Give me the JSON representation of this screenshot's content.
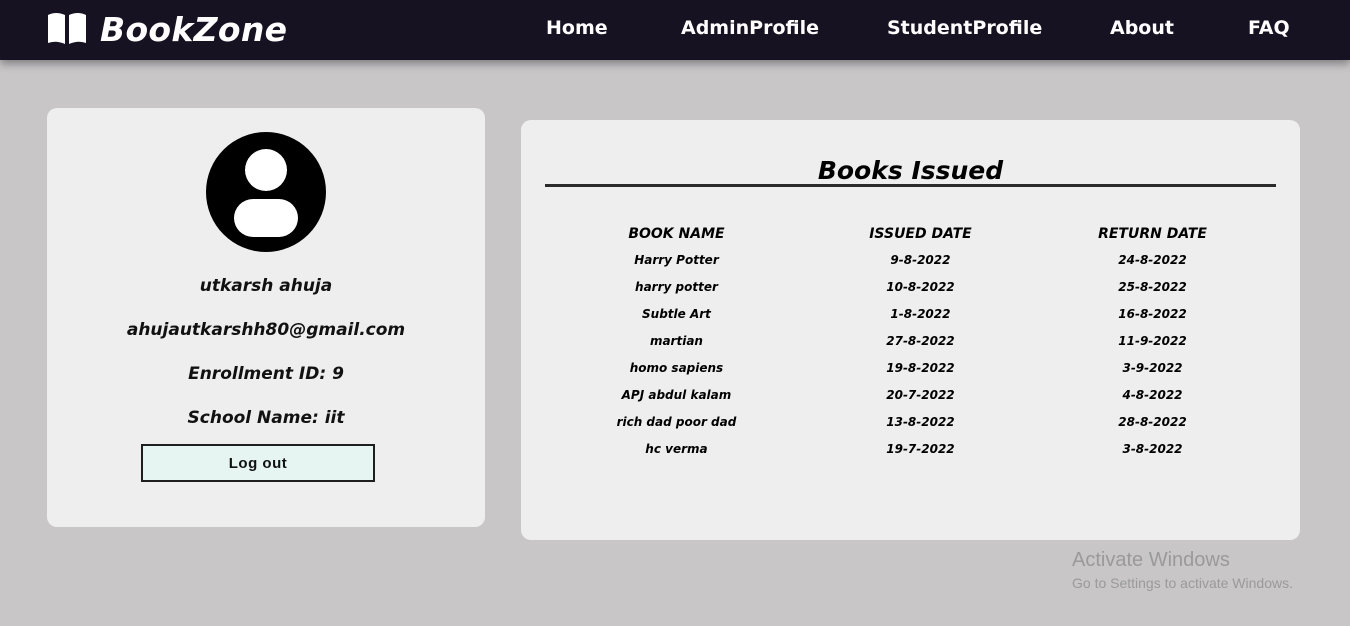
{
  "brand": {
    "name": "BookZone",
    "icon": "open-book-icon"
  },
  "nav": {
    "items": [
      {
        "label": "Home"
      },
      {
        "label": "AdminProfile"
      },
      {
        "label": "StudentProfile"
      },
      {
        "label": "About"
      },
      {
        "label": "FAQ"
      }
    ]
  },
  "profile": {
    "avatar_icon": "user-avatar-icon",
    "name": "utkarsh ahuja",
    "email": "ahujautkarshh80@gmail.com",
    "enrollment": "Enrollment ID: 9",
    "school": "School Name: iit",
    "logout_label": "Log out"
  },
  "books": {
    "title": "Books Issued",
    "columns": [
      "BOOK NAME",
      "ISSUED DATE",
      "RETURN DATE"
    ],
    "rows": [
      [
        "Harry Potter",
        "9-8-2022",
        "24-8-2022"
      ],
      [
        "harry potter",
        "10-8-2022",
        "25-8-2022"
      ],
      [
        "Subtle Art",
        "1-8-2022",
        "16-8-2022"
      ],
      [
        "martian",
        "27-8-2022",
        "11-9-2022"
      ],
      [
        "homo sapiens",
        "19-8-2022",
        "3-9-2022"
      ],
      [
        "APJ abdul kalam",
        "20-7-2022",
        "4-8-2022"
      ],
      [
        "rich dad poor dad",
        "13-8-2022",
        "28-8-2022"
      ],
      [
        "hc verma",
        "19-7-2022",
        "3-8-2022"
      ]
    ]
  },
  "watermark": {
    "title": "Activate Windows",
    "subtitle": "Go to Settings to activate Windows."
  },
  "colors": {
    "navbar_bg": "#171222",
    "page_bg": "#c8c6c7",
    "card_bg": "#eeeeee",
    "button_bg": "#e6f5f1"
  }
}
